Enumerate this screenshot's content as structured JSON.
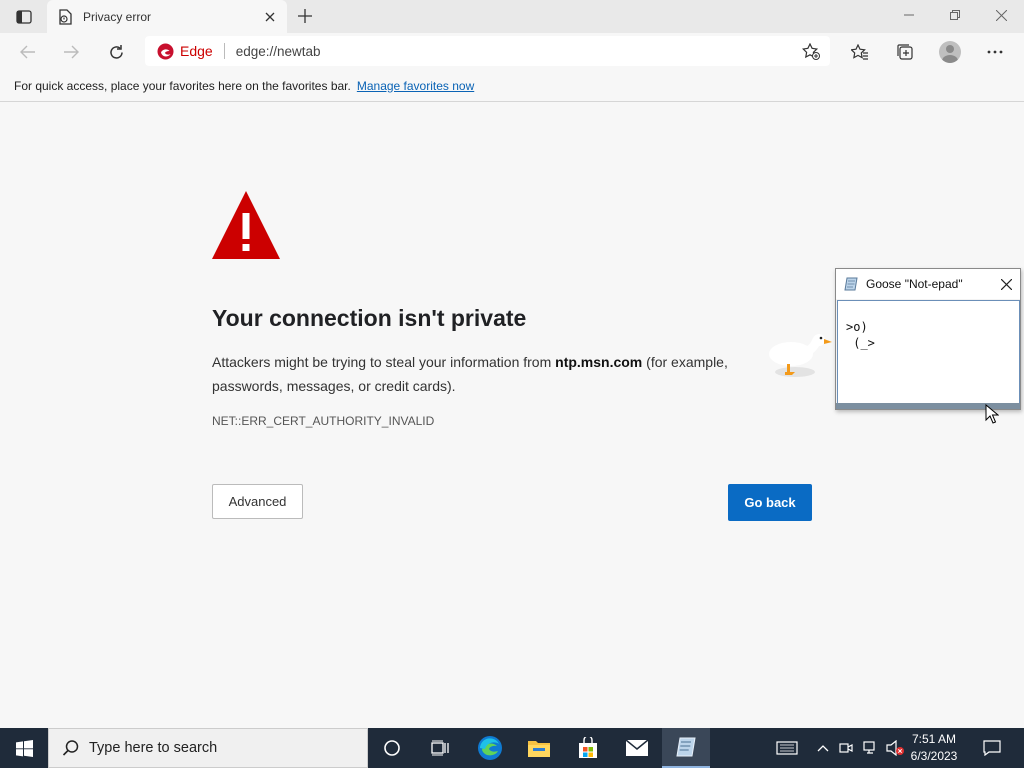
{
  "browser": {
    "tab": {
      "title": "Privacy error"
    },
    "address": {
      "badge": "Edge",
      "url": "edge://newtab"
    },
    "favorites_bar": {
      "hint": "For quick access, place your favorites here on the favorites bar.",
      "manage_link": "Manage favorites now"
    }
  },
  "page": {
    "heading": "Your connection isn't private",
    "description_prefix": "Attackers might be trying to steal your information from ",
    "host": "ntp.msn.com",
    "description_suffix": " (for example, passwords, messages, or credit cards).",
    "error_code": "NET::ERR_CERT_AUTHORITY_INVALID",
    "advanced_label": "Advanced",
    "go_back_label": "Go back",
    "warning_color": "#cc0000",
    "primary_color": "#0a6bc4"
  },
  "notepad": {
    "title": "Goose \"Not-epad\"",
    "line1": ">o)",
    "line2": " (_>"
  },
  "taskbar": {
    "search_placeholder": "Type here to search",
    "time": "7:51 AM",
    "date": "6/3/2023",
    "apps": [
      "cortana-icon",
      "task-view-icon",
      "edge-icon",
      "file-explorer-icon",
      "store-icon",
      "mail-icon",
      "notepad-icon"
    ]
  }
}
